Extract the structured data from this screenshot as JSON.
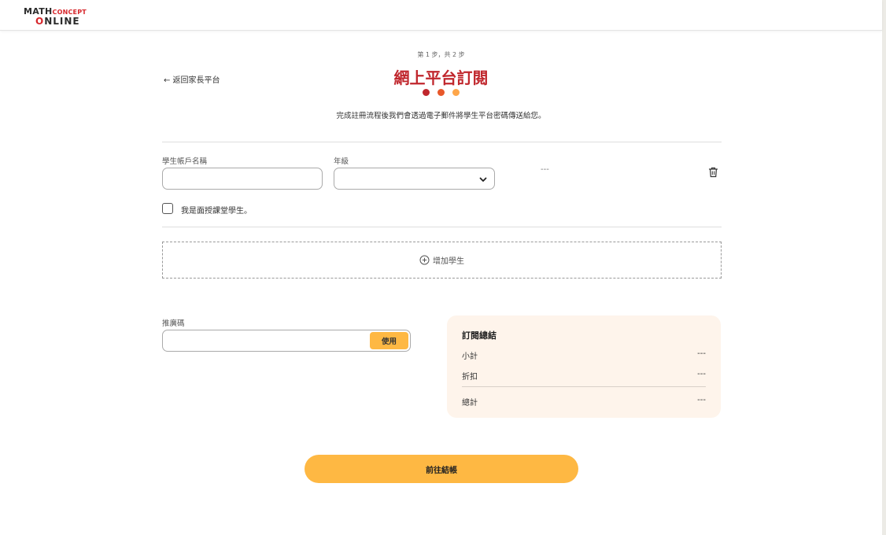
{
  "header": {
    "logo_math": "MATH",
    "logo_concept": "CONCEPT",
    "logo_online_o": "O",
    "logo_online_rest": "NLINE"
  },
  "nav": {
    "back_label": "← 返回家長平台"
  },
  "steps": {
    "indicator": "第 1 步，共 2 步",
    "dot_colors": [
      "#c0272d",
      "#e8582a",
      "#fea64a"
    ]
  },
  "page": {
    "title": "網上平台訂閱",
    "description": "完成註冊流程後我們會透過電子郵件將學生平台密碼傳送給您。"
  },
  "student": {
    "account_name_label": "學生帳戶名稱",
    "account_name_value": "",
    "grade_label": "年級",
    "grade_value": "",
    "price": "---",
    "checkbox_label": "我是面授課堂學生。",
    "add_label": "增加學生"
  },
  "promo": {
    "label": "推廣碼",
    "value": "",
    "apply_label": "使用"
  },
  "summary": {
    "title": "訂閱總結",
    "subtotal_label": "小計",
    "subtotal_value": "---",
    "discount_label": "折扣",
    "discount_value": "---",
    "total_label": "總計",
    "total_value": "---"
  },
  "checkout": {
    "label": "前往結帳"
  },
  "colors": {
    "accent": "#feb843",
    "brand_red": "#c0272d",
    "summary_bg": "#fef4eb"
  }
}
